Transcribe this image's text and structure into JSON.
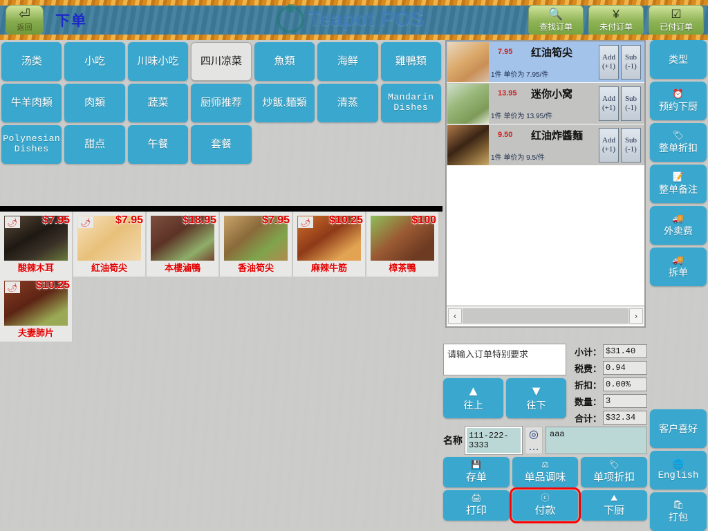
{
  "header": {
    "back_label": "返回",
    "back_icon": "back-arrow-icon",
    "title": "下单",
    "logo_text": "Teapot POS",
    "buttons": [
      {
        "label": "查找订单",
        "icon": "search-icon"
      },
      {
        "label": "未付订单",
        "icon": "unpaid-currency-icon"
      },
      {
        "label": "已付订单",
        "icon": "paid-receipt-icon"
      }
    ]
  },
  "categories": [
    {
      "label": "汤类",
      "selected": false,
      "en": false
    },
    {
      "label": "小吃",
      "selected": false,
      "en": false
    },
    {
      "label": "川味小吃",
      "selected": false,
      "en": false
    },
    {
      "label": "四川凉菜",
      "selected": true,
      "en": false
    },
    {
      "label": "魚類",
      "selected": false,
      "en": false
    },
    {
      "label": "海鲜",
      "selected": false,
      "en": false
    },
    {
      "label": "雞鴨類",
      "selected": false,
      "en": false
    },
    {
      "label": "牛羊肉類",
      "selected": false,
      "en": false
    },
    {
      "label": "肉類",
      "selected": false,
      "en": false
    },
    {
      "label": "蔬菜",
      "selected": false,
      "en": false
    },
    {
      "label": "厨师推荐",
      "selected": false,
      "en": false
    },
    {
      "label": "炒飯.麵類",
      "selected": false,
      "en": false
    },
    {
      "label": "清蒸",
      "selected": false,
      "en": false
    },
    {
      "label": "Mandarin Dishes",
      "selected": false,
      "en": true
    },
    {
      "label": "Polynesian Dishes",
      "selected": false,
      "en": true
    },
    {
      "label": "甜点",
      "selected": false,
      "en": false
    },
    {
      "label": "午餐",
      "selected": false,
      "en": false
    },
    {
      "label": "套餐",
      "selected": false,
      "en": false
    }
  ],
  "products": [
    {
      "name": "酸辣木耳",
      "price": "$7.95",
      "spicy": true
    },
    {
      "name": "紅油筍尖",
      "price": "$7.95",
      "spicy": true
    },
    {
      "name": "本樓滷鴨",
      "price": "$18.95",
      "spicy": false
    },
    {
      "name": "香油筍尖",
      "price": "$7.95",
      "spicy": false
    },
    {
      "name": "麻辣牛筋",
      "price": "$10.25",
      "spicy": true
    },
    {
      "name": "樟茶鴨",
      "price": "$100",
      "spicy": false
    },
    {
      "name": "夫妻肺片",
      "price": "$10.25",
      "spicy": true
    }
  ],
  "order_items": [
    {
      "price": "7.95",
      "name": "红油筍尖",
      "sub": "1件 单价为 7.95/件",
      "add": "Add",
      "add2": "(+1)",
      "sub_btn": "Sub",
      "sub2": "(-1)",
      "selected": true
    },
    {
      "price": "13.95",
      "name": "迷你小窝",
      "sub": "1件 单价为 13.95/件",
      "add": "Add",
      "add2": "(+1)",
      "sub_btn": "Sub",
      "sub2": "(-1)",
      "selected": false
    },
    {
      "price": "9.50",
      "name": "红油炸醬麵",
      "sub": "1件 单价为 9.5/件",
      "add": "Add",
      "add2": "(+1)",
      "sub_btn": "Sub",
      "sub2": "(-1)",
      "selected": false
    }
  ],
  "scroll": {
    "left_arrow": "‹",
    "right_arrow": "›"
  },
  "sidebar_top": [
    {
      "label": "类型",
      "icon": ""
    },
    {
      "label": "预约下厨",
      "icon": "alarm-clock-icon"
    },
    {
      "label": "整单折扣",
      "icon": "discount-tag-icon"
    },
    {
      "label": "整单备注",
      "icon": "note-icon"
    },
    {
      "label": "外卖费",
      "icon": "delivery-truck-icon"
    },
    {
      "label": "拆单",
      "icon": "split-order-icon"
    }
  ],
  "sidebar_bottom": [
    {
      "label": "客户喜好",
      "icon": ""
    },
    {
      "label": "English",
      "icon": "globe-icon",
      "en": true
    },
    {
      "label": "打包",
      "icon": "takeout-bag-icon"
    }
  ],
  "note": {
    "placeholder": "请输入订单特别要求",
    "value": ""
  },
  "nav": [
    {
      "label": "往上",
      "icon": "up-arrow-icon"
    },
    {
      "label": "往下",
      "icon": "down-arrow-icon"
    }
  ],
  "totals": [
    {
      "label": "小计：",
      "value": "$31.40"
    },
    {
      "label": "税费：",
      "value": "0.94"
    },
    {
      "label": "折扣：",
      "value": "0.00%"
    },
    {
      "label": "数量：",
      "value": "3"
    },
    {
      "label": "合计：",
      "value": "$32.34"
    }
  ],
  "customer": {
    "label": "名称",
    "phone": "111-222-3333",
    "location_icon": "location-pin-icon",
    "location_dots": "…",
    "note": "aaa"
  },
  "actions": [
    {
      "label": "存单",
      "icon": "save-disk-icon",
      "highlight": false
    },
    {
      "label": "单品调味",
      "icon": "seasoning-icon",
      "highlight": false
    },
    {
      "label": "单项折扣",
      "icon": "discount-tag-icon",
      "highlight": false
    },
    {
      "label": "打印",
      "icon": "printer-icon",
      "highlight": false
    },
    {
      "label": "付款",
      "icon": "payment-dollar-icon",
      "highlight": true
    },
    {
      "label": "下厨",
      "icon": "kitchen-icon",
      "highlight": false
    }
  ],
  "colors": {
    "accent": "#3aa8ce",
    "header": "#3e7d9d",
    "price": "#e10000",
    "selected_row": "#a3c3ea",
    "highlight": "#ff0000"
  }
}
